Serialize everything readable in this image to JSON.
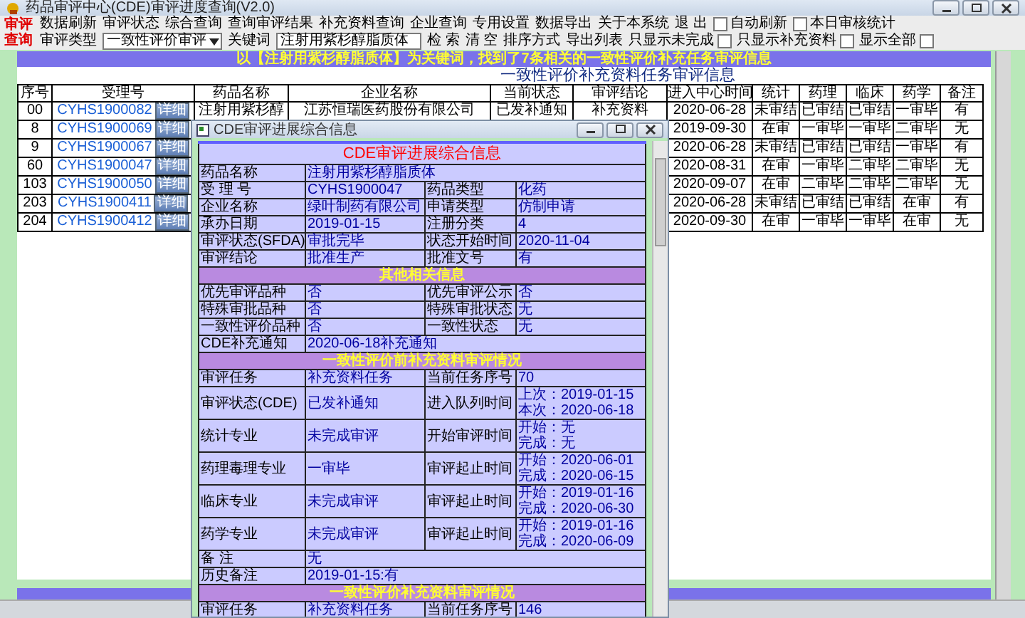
{
  "window": {
    "title": "药品审评中心(CDE)审评进度查询(V2.0)"
  },
  "logo": [
    "审评",
    "查询"
  ],
  "toolbar": {
    "row1": [
      "数据刷新",
      "审评状态",
      "综合查询",
      "查询审评结果",
      "补充资料查询",
      "企业查询",
      "专用设置",
      "数据导出",
      "关于本系统",
      "退 出"
    ],
    "row1_checks": [
      {
        "label": "自动刷新",
        "checked": false
      },
      {
        "label": "本日审核统计",
        "checked": false
      }
    ],
    "type_label": "审评类型",
    "type_value": "一致性评价审评",
    "keyword_label": "关键词",
    "keyword_value": "注射用紫杉醇脂质体",
    "row2": [
      "检 索",
      "清 空",
      "排序方式",
      "导出列表"
    ],
    "row2_checks": [
      {
        "label": "只显示未完成",
        "checked": false
      },
      {
        "label": "只显示补充资料",
        "checked": false
      },
      {
        "label": "显示全部",
        "checked": false
      }
    ]
  },
  "banner": "以【注射用紫杉醇脂质体】为关键词，找到了7条相关的一致性评价补充任务审评信息",
  "heading": "一致性评价补充资料任务审评信息",
  "table": {
    "columns": [
      "序号",
      "受理号",
      "药品名称",
      "企业名称",
      "当前状态",
      "审评结论",
      "进入中心时间",
      "统计",
      "药理",
      "临床",
      "药学",
      "备注"
    ],
    "rows": [
      {
        "detail": "详细",
        "cells": [
          "00",
          "CYHS1900082",
          "注射用紫杉醇",
          "江苏恒瑞医药股份有限公司",
          "已发补通知",
          "补充资料",
          "2020-06-28",
          "未审结",
          "已审结",
          "已审结",
          "一审毕",
          "有"
        ]
      },
      {
        "detail": "详细",
        "cells": [
          "8",
          "CYHS1900069",
          null,
          null,
          null,
          null,
          "2019-09-30",
          "在审",
          "一审毕",
          "一审毕",
          "二审毕",
          "无"
        ]
      },
      {
        "detail": "详细",
        "cells": [
          "9",
          "CYHS1900067",
          null,
          null,
          null,
          null,
          "2020-06-28",
          "未审结",
          "已审结",
          "已审结",
          "一审毕",
          "有"
        ]
      },
      {
        "detail": "详细",
        "cells": [
          "60",
          "CYHS1900047",
          null,
          null,
          null,
          null,
          "2020-08-31",
          "在审",
          "一审毕",
          "二审毕",
          "二审毕",
          "无"
        ]
      },
      {
        "detail": "详细",
        "cells": [
          "103",
          "CYHS1900050",
          null,
          null,
          null,
          null,
          "2020-09-07",
          "在审",
          "二审毕",
          "二审毕",
          "二审毕",
          "无"
        ]
      },
      {
        "detail": "详细",
        "cells": [
          "203",
          "CYHS1900411",
          null,
          null,
          null,
          null,
          "2020-06-28",
          "未审结",
          "已审结",
          "已审结",
          "在审",
          "有"
        ]
      },
      {
        "detail": "详细",
        "cells": [
          "204",
          "CYHS1900412",
          null,
          null,
          null,
          null,
          "2020-09-30",
          "在审",
          "一审毕",
          "一审毕",
          "在审",
          "无"
        ]
      }
    ]
  },
  "dialog": {
    "title": "CDE审评进展综合信息",
    "rows": [
      {
        "kind": "heading",
        "text": "CDE审评进展综合信息"
      },
      {
        "kind": "wide",
        "label": "药品名称",
        "value": "注射用紫杉醇脂质体"
      },
      {
        "kind": "pair",
        "cells": [
          {
            "label": "受 理 号",
            "value": "CYHS1900047"
          },
          {
            "label": "药品类型",
            "value": "化药"
          }
        ]
      },
      {
        "kind": "pair",
        "cells": [
          {
            "label": "企业名称",
            "value": "绿叶制药有限公司"
          },
          {
            "label": "申请类型",
            "value": "仿制申请"
          }
        ]
      },
      {
        "kind": "pair",
        "cells": [
          {
            "label": "承办日期",
            "value": "2019-01-15"
          },
          {
            "label": "注册分类",
            "value": "4"
          }
        ]
      },
      {
        "kind": "pair",
        "cells": [
          {
            "label": "审评状态(SFDA)",
            "value": "审批完毕"
          },
          {
            "label": "状态开始时间",
            "value": "2020-11-04"
          }
        ]
      },
      {
        "kind": "pair",
        "cells": [
          {
            "label": "审评结论",
            "value": "批准生产"
          },
          {
            "label": "批准文号",
            "value": "有"
          }
        ]
      },
      {
        "kind": "section",
        "text": "其他相关信息"
      },
      {
        "kind": "pair",
        "cells": [
          {
            "label": "优先审评品种",
            "value": "否"
          },
          {
            "label": "优先审评公示",
            "value": "否"
          }
        ]
      },
      {
        "kind": "pair",
        "cells": [
          {
            "label": "特殊审批品种",
            "value": "否"
          },
          {
            "label": "特殊审批状态",
            "value": "无"
          }
        ]
      },
      {
        "kind": "pair",
        "cells": [
          {
            "label": "一致性评价品种",
            "value": "否"
          },
          {
            "label": "一致性状态",
            "value": "无"
          }
        ]
      },
      {
        "kind": "wide",
        "label": "CDE补充通知",
        "value": "2020-06-18补充通知"
      },
      {
        "kind": "section",
        "text": "一致性评价前补充资料审评情况"
      },
      {
        "kind": "pair",
        "cells": [
          {
            "label": "审评任务",
            "value": "补充资料任务"
          },
          {
            "label": "当前任务序号",
            "value": "70"
          }
        ]
      },
      {
        "kind": "pair",
        "cells": [
          {
            "label": "审评状态(CDE)",
            "value": "已发补通知"
          },
          {
            "label": "进入队列时间",
            "lines": [
              "上次：2019-01-15",
              "本次：2020-06-18"
            ]
          }
        ]
      },
      {
        "kind": "pair",
        "cells": [
          {
            "label": "统计专业",
            "value": "未完成审评"
          },
          {
            "label": "开始审评时间",
            "lines": [
              "开始：无",
              "完成：无"
            ]
          }
        ]
      },
      {
        "kind": "pair",
        "cells": [
          {
            "label": "药理毒理专业",
            "value": "一审毕"
          },
          {
            "label": "审评起止时间",
            "lines": [
              "开始：2020-06-01",
              "完成：2020-06-15"
            ]
          }
        ]
      },
      {
        "kind": "pair",
        "cells": [
          {
            "label": "临床专业",
            "value": "未完成审评"
          },
          {
            "label": "审评起止时间",
            "lines": [
              "开始：2019-01-16",
              "完成：2020-06-30"
            ]
          }
        ]
      },
      {
        "kind": "pair",
        "cells": [
          {
            "label": "药学专业",
            "value": "未完成审评"
          },
          {
            "label": "审评起止时间",
            "lines": [
              "开始：2019-01-16",
              "完成：2020-06-09"
            ]
          }
        ]
      },
      {
        "kind": "wide",
        "label": "备 注",
        "value": "无"
      },
      {
        "kind": "wide",
        "label": "历史备注",
        "value": "2019-01-15:有"
      },
      {
        "kind": "section",
        "text": "一致性评价补充资料审评情况"
      },
      {
        "kind": "pair",
        "cells": [
          {
            "label": "审评任务",
            "value": "补充资料任务"
          },
          {
            "label": "当前任务序号",
            "value": "146"
          }
        ]
      }
    ]
  }
}
